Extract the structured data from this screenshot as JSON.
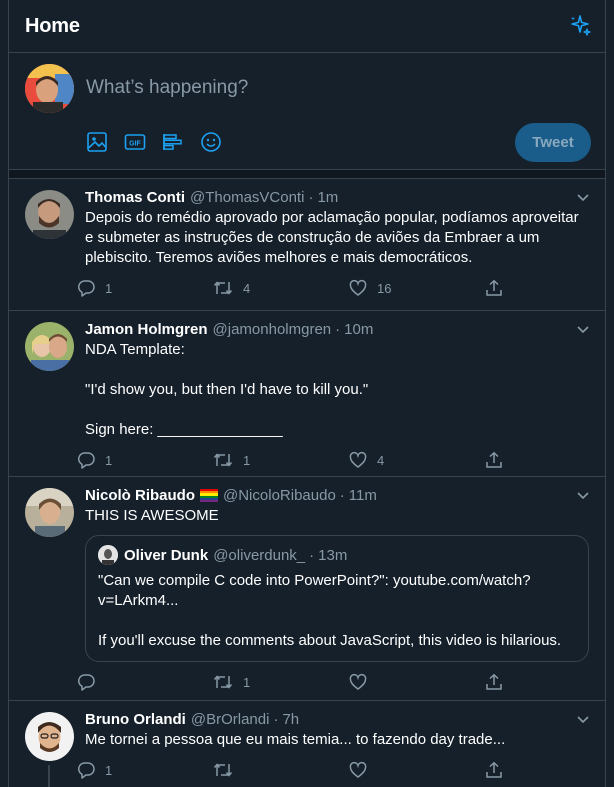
{
  "header": {
    "title": "Home",
    "icon": "sparkle-icon"
  },
  "composer": {
    "placeholder": "What’s happening?",
    "tools": [
      "image-icon",
      "gif-icon",
      "poll-icon",
      "emoji-icon"
    ],
    "tweet_label": "Tweet"
  },
  "colors": {
    "accent": "#1da1f2",
    "background": "#15202b",
    "secondary_text": "#8899a6",
    "border": "#38444d"
  },
  "tweets": [
    {
      "name": "Thomas Conti",
      "handle": "@ThomasVConti",
      "dot": "·",
      "time": "1m",
      "text": "Depois do remédio aprovado por aclamação popular, podíamos aproveitar e submeter as instruções de construção de aviões da Embraer a um plebiscito. Teremos aviões melhores e mais democráticos.",
      "replies": "1",
      "retweets": "4",
      "likes": "16"
    },
    {
      "name": "Jamon Holmgren",
      "handle": "@jamonholmgren",
      "dot": "·",
      "time": "10m",
      "text": "NDA Template:\n\n\"I'd show you, but then I'd have to kill you.\"\n\nSign here: _______________",
      "replies": "1",
      "retweets": "1",
      "likes": "4"
    },
    {
      "name": "Nicolò Ribaudo",
      "flag": "🏳️‍🌈",
      "handle": "@NicoloRibaudo",
      "dot": "·",
      "time": "11m",
      "text": "THIS IS AWESOME",
      "quote": {
        "name": "Oliver Dunk",
        "handle": "@oliverdunk_",
        "dot": "·",
        "time": "13m",
        "text": "\"Can we compile C code into PowerPoint?\": youtube.com/watch?v=LArkm4...\n\nIf you'll excuse the comments about JavaScript, this video is hilarious."
      },
      "replies": "",
      "retweets": "1",
      "likes": ""
    },
    {
      "name": "Bruno Orlandi",
      "handle": "@BrOrlandi",
      "dot": "·",
      "time": "7h",
      "text": "Me tornei a pessoa que eu mais temia... to fazendo day trade...",
      "replies": "1",
      "retweets": "",
      "likes": ""
    }
  ]
}
